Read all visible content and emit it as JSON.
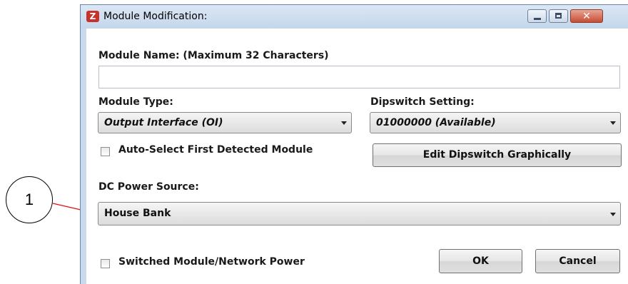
{
  "callout": {
    "number": "1"
  },
  "window": {
    "title": "Module Modification:",
    "close_glyph": "✕"
  },
  "module_name": {
    "label": "Module Name: (Maximum 32 Characters)",
    "value": ""
  },
  "module_type": {
    "label": "Module Type:",
    "selected": "Output Interface (OI)"
  },
  "dipswitch": {
    "label": "Dipswitch Setting:",
    "selected": "01000000 (Available)",
    "edit_button": "Edit Dipswitch Graphically"
  },
  "auto_select": {
    "label": "Auto-Select First Detected Module",
    "checked": false
  },
  "dc_power": {
    "label": "DC Power Source:",
    "selected": "House Bank"
  },
  "switched_power": {
    "label": "Switched Module/Network Power",
    "checked": false
  },
  "buttons": {
    "ok": "OK",
    "cancel": "Cancel"
  }
}
